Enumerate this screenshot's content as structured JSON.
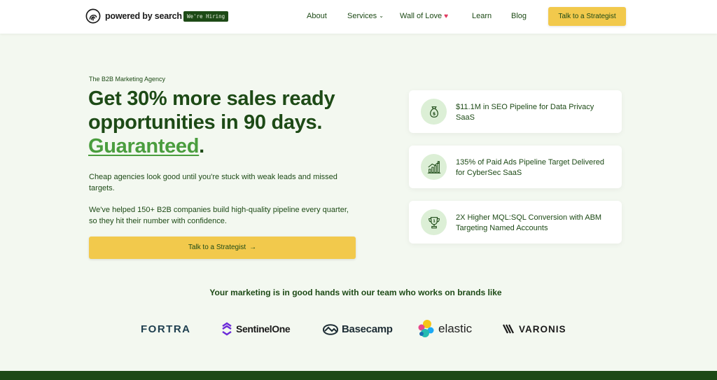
{
  "header": {
    "logo_text": "powered by search",
    "hiring_badge": "We're Hiring",
    "nav": {
      "about": "About",
      "services": "Services",
      "wall_of_love": "Wall of Love",
      "learn": "Learn",
      "blog": "Blog"
    },
    "cta": "Talk to a Strategist"
  },
  "hero": {
    "eyebrow": "The B2B Marketing Agency",
    "headline_part1": "Get 30% more sales ready opportunities in 90 days.",
    "headline_highlight": "Guaranteed",
    "headline_end": ".",
    "paragraph1": "Cheap agencies look good until you're stuck with weak leads and missed targets.",
    "paragraph2": "We've helped 150+ B2B companies build high-quality pipeline every quarter, so they hit their number with confidence.",
    "cta": "Talk to a Strategist",
    "cta_arrow": "→"
  },
  "stats": [
    {
      "icon": "money-bag-icon",
      "text": "$11.1M in SEO Pipeline for Data Privacy SaaS"
    },
    {
      "icon": "growth-chart-icon",
      "text": "135% of Paid Ads Pipeline Target Delivered for CyberSec SaaS"
    },
    {
      "icon": "trophy-icon",
      "text": "2X Higher MQL:SQL Conversion with ABM Targeting Named Accounts"
    }
  ],
  "brands": {
    "title": "Your marketing is in good hands with our team who works on brands like",
    "items": [
      "FORTRA",
      "SentinelOne",
      "Basecamp",
      "elastic",
      "VARONIS"
    ]
  },
  "colors": {
    "primary_green": "#1d4a16",
    "accent_green": "#4a9d3e",
    "cta_yellow": "#f2c94c",
    "background": "#f3f8f0"
  }
}
